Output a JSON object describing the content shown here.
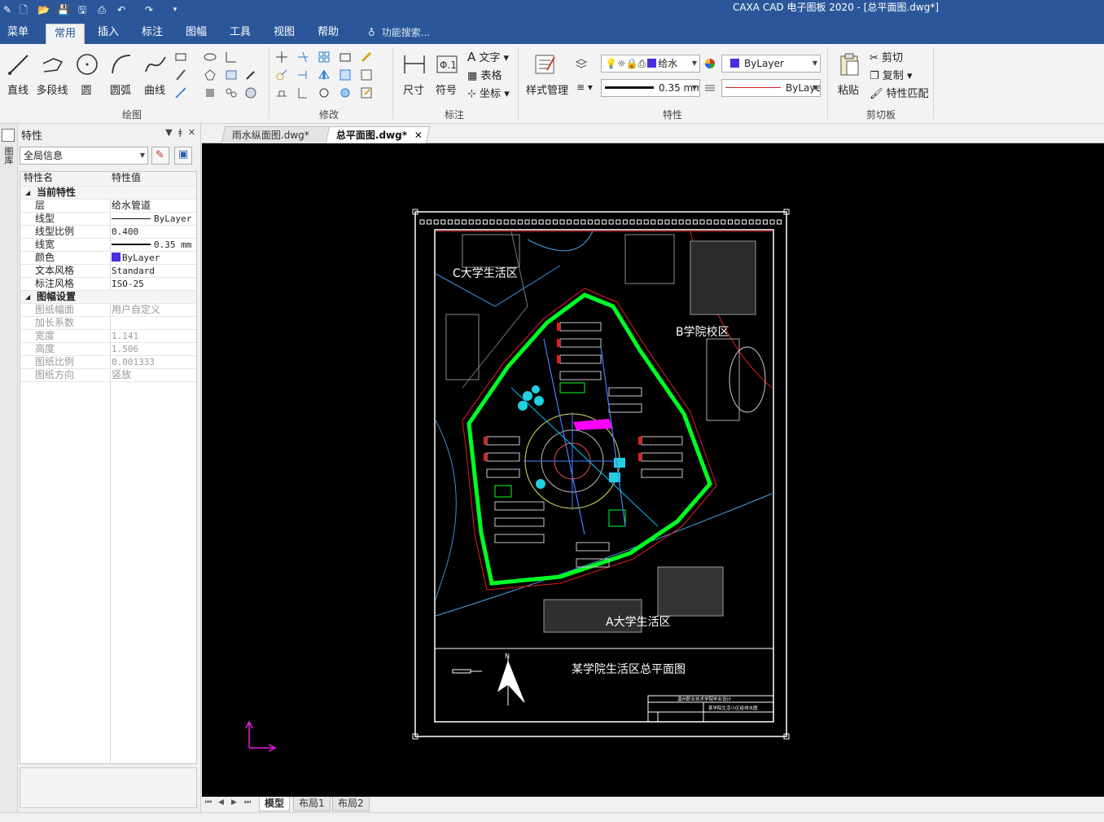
{
  "window": {
    "title": "CAXA CAD 电子图板 2020 - [总平面图.dwg*]"
  },
  "menu": {
    "tabs": [
      {
        "label": "菜单"
      },
      {
        "label": "常用"
      },
      {
        "label": "插入"
      },
      {
        "label": "标注"
      },
      {
        "label": "图幅"
      },
      {
        "label": "工具"
      },
      {
        "label": "视图"
      },
      {
        "label": "帮助"
      }
    ],
    "search": "功能搜索..."
  },
  "ribbon": {
    "draw": {
      "label": "绘图",
      "line": "直线",
      "polyline": "多段线",
      "circle": "圆",
      "arc": "圆弧",
      "curve": "曲线"
    },
    "modify": {
      "label": "修改"
    },
    "annotate": {
      "label": "标注",
      "dimension": "尺寸",
      "symbol": "符号",
      "text": "文字",
      "table": "表格",
      "coord": "坐标"
    },
    "props": {
      "label": "特性",
      "style_manager": "样式管理",
      "layer_value": "给水",
      "color_value": "ByLayer",
      "lineweight_value": "0.35 mm",
      "linetype_value": "ByLayer"
    },
    "clipboard": {
      "label": "剪切板",
      "paste": "粘贴",
      "cut": "剪切",
      "copy": "复制",
      "match": "特性匹配"
    }
  },
  "panel": {
    "title": "特性",
    "selector": "全局信息",
    "side_tab": "图库",
    "header": {
      "name": "特性名",
      "value": "特性值"
    },
    "sections": [
      {
        "title": "当前特性",
        "rows": [
          {
            "name": "层",
            "value": "给水管道"
          },
          {
            "name": "线型",
            "value": "ByLayer"
          },
          {
            "name": "线型比例",
            "value": "0.400"
          },
          {
            "name": "线宽",
            "value": "0.35 mm"
          },
          {
            "name": "颜色",
            "value": "ByLayer"
          },
          {
            "name": "文本风格",
            "value": "Standard"
          },
          {
            "name": "标注风格",
            "value": "ISO-25"
          }
        ]
      },
      {
        "title": "图幅设置",
        "rows": [
          {
            "name": "图纸幅面",
            "value": "用户自定义"
          },
          {
            "name": "加长系数",
            "value": ""
          },
          {
            "name": "宽度",
            "value": "1.141"
          },
          {
            "name": "高度",
            "value": "1.506"
          },
          {
            "name": "图纸比例",
            "value": "0.001333"
          },
          {
            "name": "图纸方向",
            "value": "竖放"
          }
        ]
      }
    ]
  },
  "doc_tabs": [
    {
      "label": "雨水纵面图.dwg*"
    },
    {
      "label": "总平面图.dwg*"
    }
  ],
  "layout_tabs": [
    {
      "label": "模型"
    },
    {
      "label": "布局1"
    },
    {
      "label": "布局2"
    }
  ],
  "drawing": {
    "label_c": "C大学生活区",
    "label_b": "B学院校区",
    "label_a": "A大学生活区",
    "title": "某学院生活区总平面图",
    "north": "N",
    "titleblock_line1": "温州职业技术学院毕业设计",
    "titleblock_line2": "某学院生活小区给排水图"
  },
  "colors": {
    "accent": "#2b579a",
    "canvas": "#000000",
    "green": "#00ff22",
    "red": "#e02020",
    "layer_color": "#4b2ee0"
  }
}
